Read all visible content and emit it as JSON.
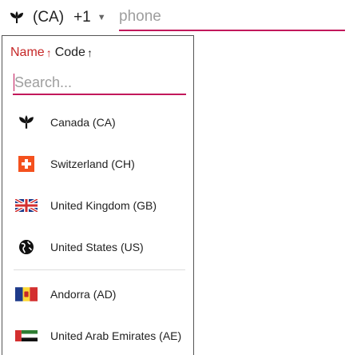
{
  "selector": {
    "flag_icon": "maple-leaf-icon",
    "code": "(CA)",
    "dial": "+1",
    "caret": "▼"
  },
  "phone": {
    "placeholder": "phone",
    "value": ""
  },
  "dropdown": {
    "sort_name": "Name",
    "sort_code": "Code",
    "sort_arrow": "↑",
    "search_placeholder": "Search...",
    "preferred": [
      {
        "label": "Canada (CA)",
        "flag": "maple-leaf-icon"
      },
      {
        "label": "Switzerland (CH)",
        "flag": "swiss-flag-icon"
      },
      {
        "label": "United Kingdom (GB)",
        "flag": "uk-flag-icon"
      },
      {
        "label": "United States (US)",
        "flag": "globe-icon"
      }
    ],
    "all": [
      {
        "label": "Andorra (AD)",
        "flag": "andorra-flag-icon"
      },
      {
        "label": "United Arab Emirates (AE)",
        "flag": "uae-flag-icon"
      }
    ]
  }
}
